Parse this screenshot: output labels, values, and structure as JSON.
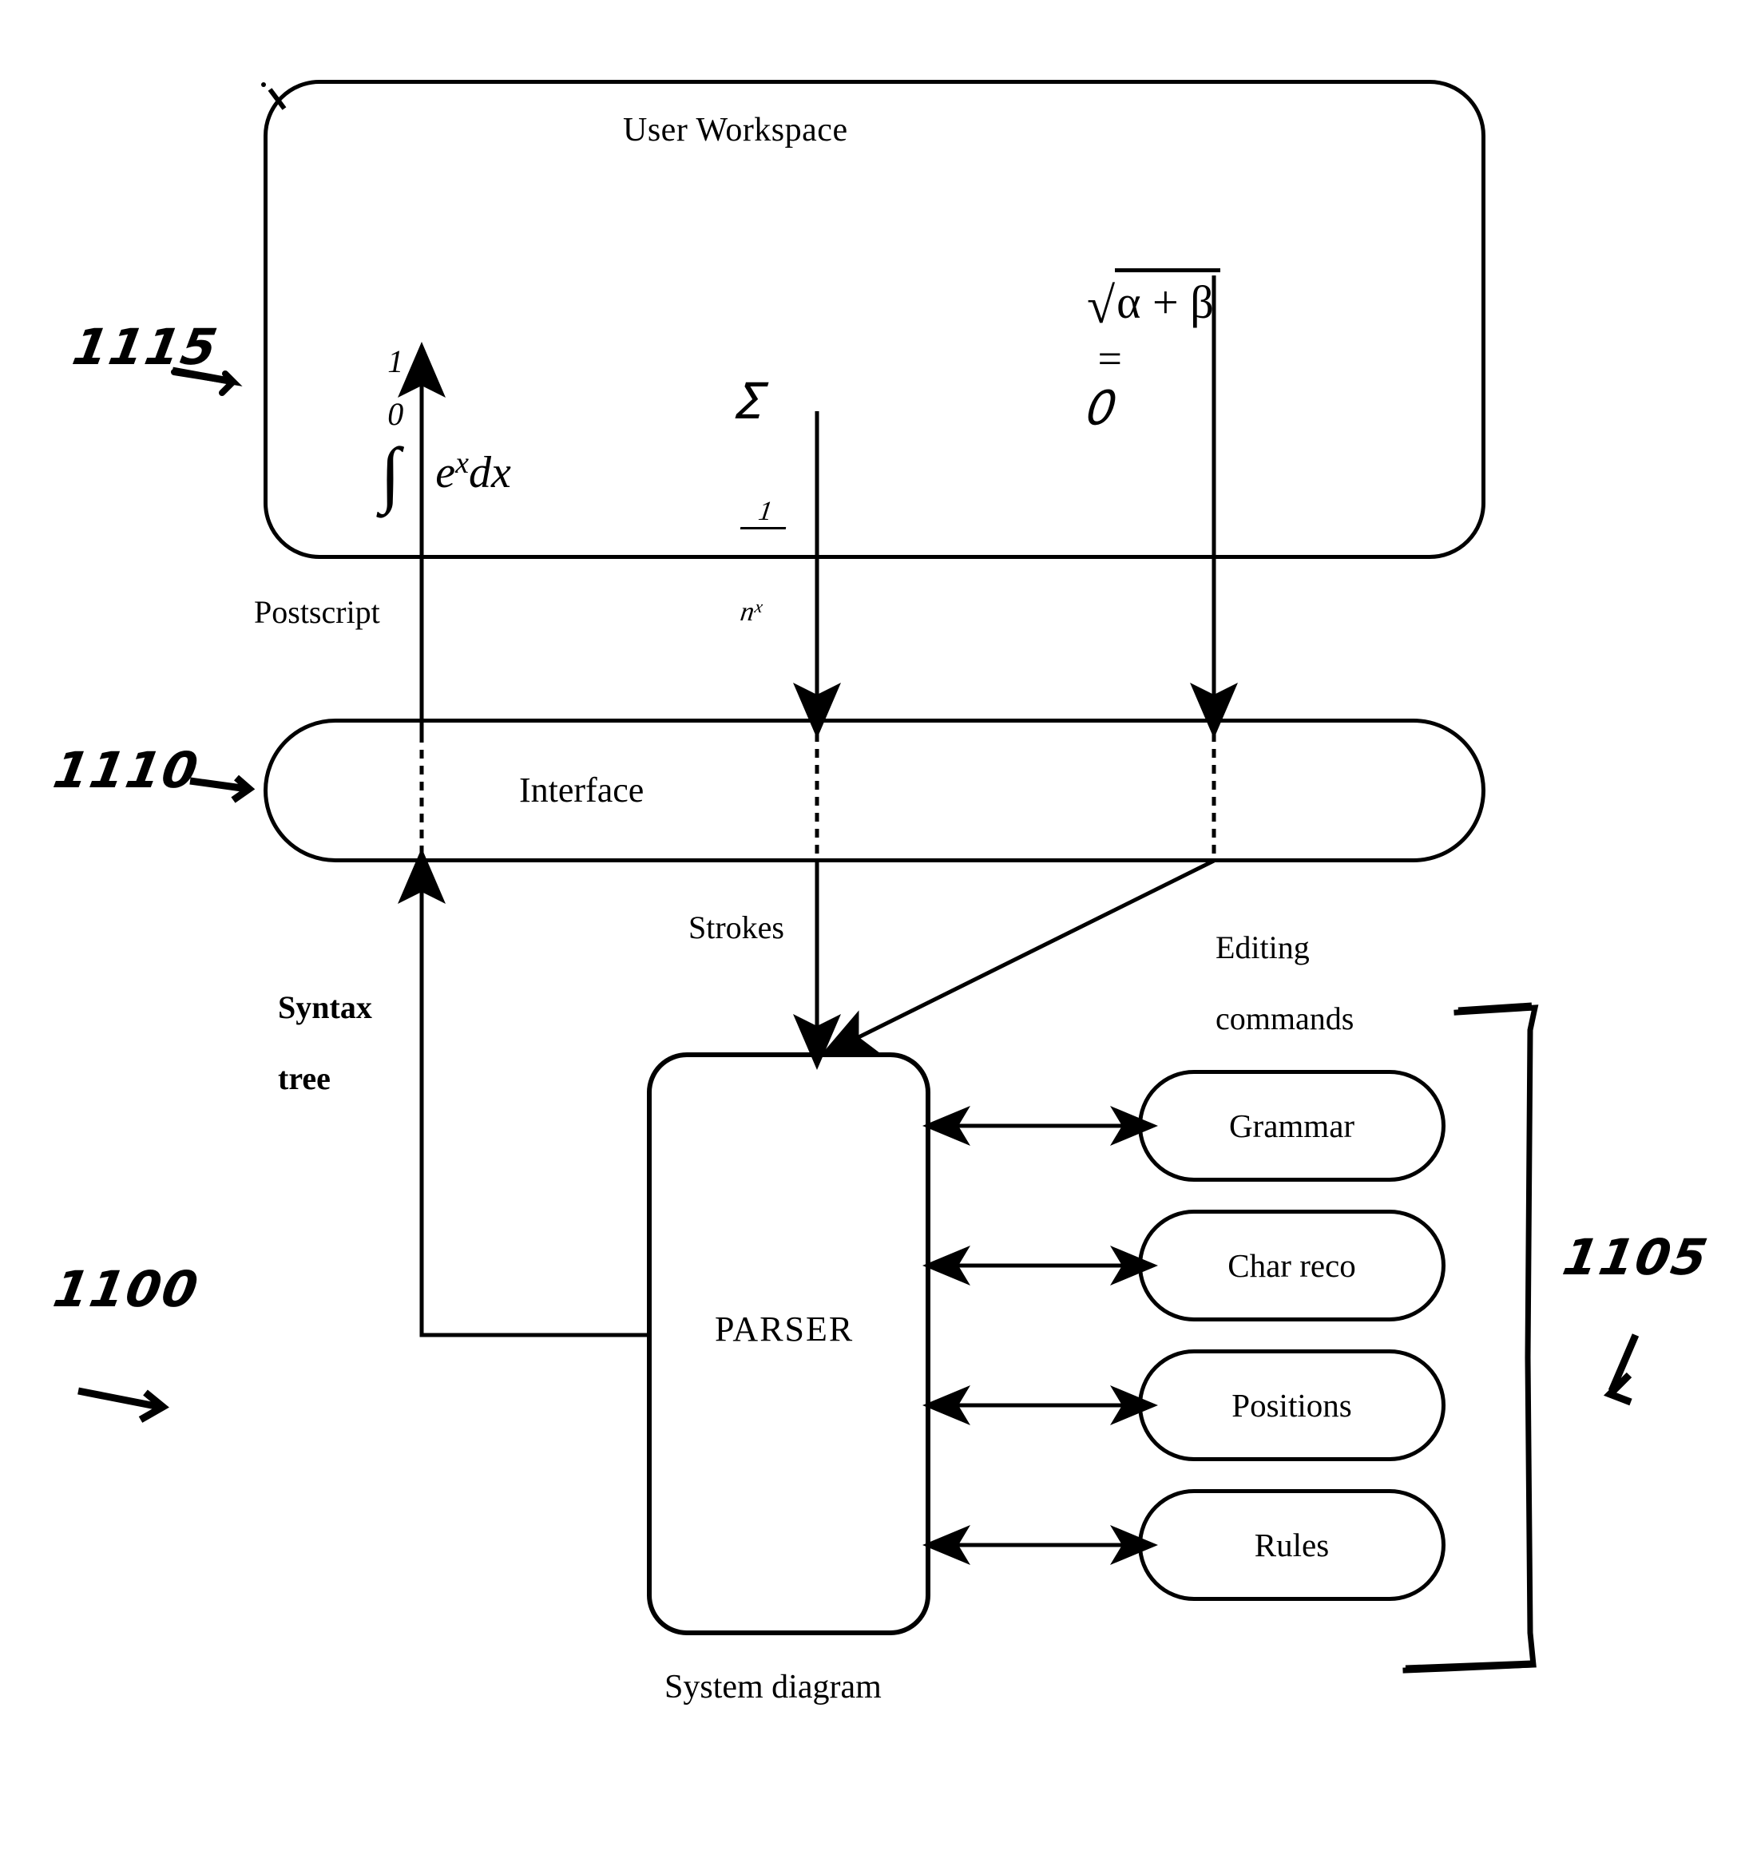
{
  "figure": {
    "caption": "System diagram",
    "workspace_title": "User Workspace",
    "interface_label": "Interface",
    "parser_label": "PARSER"
  },
  "reference_numerals": [
    {
      "id": "ref-1115",
      "text": "1115",
      "points_to": "User Workspace",
      "arrow": "right"
    },
    {
      "id": "ref-1110",
      "text": "1110",
      "points_to": "Interface",
      "arrow": "right"
    },
    {
      "id": "ref-1100",
      "text": "1100",
      "points_to": "System diagram",
      "arrow": "right"
    },
    {
      "id": "ref-1105",
      "text": "1105",
      "points_to": "Knowledge bases bracket",
      "arrow": "down-left"
    }
  ],
  "workspace": {
    "title": "User Workspace",
    "formulas": [
      {
        "id": "integral",
        "text": "∫₁₀ eˣ dx",
        "rendered": "integral from 0 to 1 of e^x dx"
      },
      {
        "id": "sum",
        "text": "Σ 1/nˣ",
        "rendered": "sum of 1 over n to the x",
        "handwritten": true
      },
      {
        "id": "sqrt",
        "text": "√(α + β) = 0",
        "rendered": "square root of alpha plus beta equals zero"
      }
    ]
  },
  "edge_labels": [
    {
      "id": "postscript",
      "text": "Postscript",
      "bold": false
    },
    {
      "id": "strokes",
      "text": "Strokes",
      "bold": false
    },
    {
      "id": "editing-commands",
      "line1": "Editing",
      "line2": "commands",
      "bold": false
    },
    {
      "id": "syntax-tree",
      "line1": "Syntax",
      "line2": "tree",
      "bold": true
    }
  ],
  "knowledge_bases": [
    {
      "id": "grammar",
      "label": "Grammar"
    },
    {
      "id": "char-reco",
      "label": "Char reco"
    },
    {
      "id": "positions",
      "label": "Positions"
    },
    {
      "id": "rules",
      "label": "Rules"
    }
  ],
  "colors": {
    "ink": "#000000",
    "paper": "#ffffff"
  }
}
